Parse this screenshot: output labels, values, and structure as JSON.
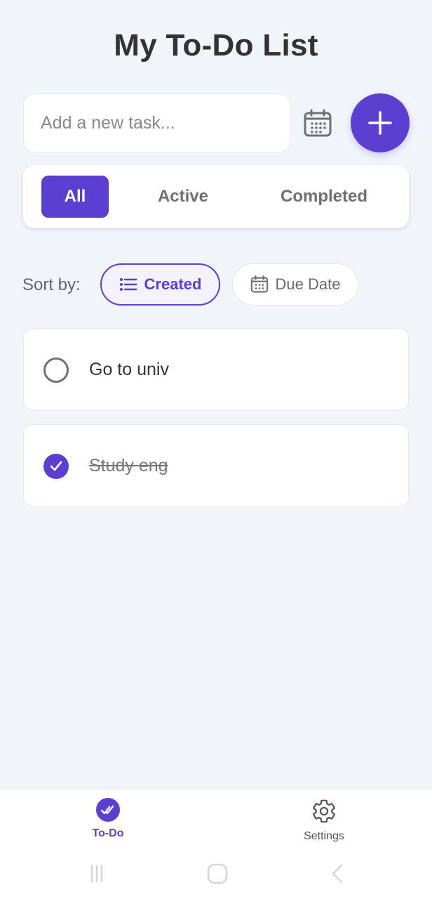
{
  "header": {
    "title": "My To-Do List"
  },
  "new_task": {
    "placeholder": "Add a new task...",
    "value": ""
  },
  "icons": {
    "calendar": "calendar-icon",
    "add": "plus-icon",
    "sort_list": "list-icon",
    "check": "checkmark-icon",
    "todo_nav": "double-check-icon",
    "settings_nav": "gear-icon"
  },
  "filters": {
    "tabs": [
      {
        "label": "All",
        "active": true
      },
      {
        "label": "Active",
        "active": false
      },
      {
        "label": "Completed",
        "active": false
      }
    ]
  },
  "sort": {
    "label": "Sort by:",
    "options": [
      {
        "label": "Created",
        "selected": true
      },
      {
        "label": "Due Date",
        "selected": false
      }
    ]
  },
  "tasks": [
    {
      "text": "Go to univ",
      "completed": false
    },
    {
      "text": "Study eng",
      "completed": true
    }
  ],
  "bottom_nav": {
    "items": [
      {
        "label": "To-Do",
        "active": true
      },
      {
        "label": "Settings",
        "active": false
      }
    ]
  },
  "colors": {
    "accent": "#5b3fd0",
    "background": "#f1f5fa",
    "card": "#ffffff"
  }
}
